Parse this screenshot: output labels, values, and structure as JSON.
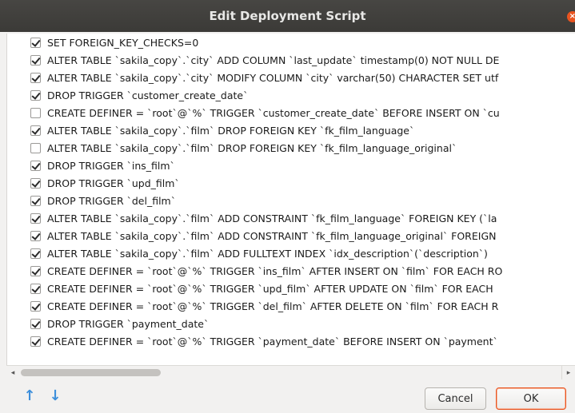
{
  "window": {
    "title": "Edit Deployment Script"
  },
  "items": [
    {
      "checked": true,
      "text": "SET FOREIGN_KEY_CHECKS=0"
    },
    {
      "checked": true,
      "text": "ALTER TABLE `sakila_copy`.`city` ADD COLUMN `last_update` timestamp(0) NOT NULL DE"
    },
    {
      "checked": true,
      "text": "ALTER TABLE `sakila_copy`.`city` MODIFY COLUMN `city` varchar(50) CHARACTER SET utf"
    },
    {
      "checked": true,
      "text": "DROP TRIGGER `customer_create_date`"
    },
    {
      "checked": false,
      "text": "CREATE DEFINER = `root`@`%` TRIGGER `customer_create_date` BEFORE INSERT ON `cu"
    },
    {
      "checked": true,
      "text": "ALTER TABLE `sakila_copy`.`film` DROP FOREIGN KEY `fk_film_language`"
    },
    {
      "checked": false,
      "text": "ALTER TABLE `sakila_copy`.`film` DROP FOREIGN KEY `fk_film_language_original`"
    },
    {
      "checked": true,
      "text": "DROP TRIGGER `ins_film`"
    },
    {
      "checked": true,
      "text": "DROP TRIGGER `upd_film`"
    },
    {
      "checked": true,
      "text": "DROP TRIGGER `del_film`"
    },
    {
      "checked": true,
      "text": "ALTER TABLE `sakila_copy`.`film` ADD CONSTRAINT `fk_film_language` FOREIGN KEY (`la"
    },
    {
      "checked": true,
      "text": "ALTER TABLE `sakila_copy`.`film` ADD CONSTRAINT `fk_film_language_original` FOREIGN"
    },
    {
      "checked": true,
      "text": "ALTER TABLE `sakila_copy`.`film` ADD FULLTEXT INDEX `idx_description`(`description`)"
    },
    {
      "checked": true,
      "text": "CREATE DEFINER = `root`@`%` TRIGGER `ins_film` AFTER INSERT ON `film` FOR EACH RO"
    },
    {
      "checked": true,
      "text": "CREATE DEFINER = `root`@`%` TRIGGER `upd_film` AFTER UPDATE ON `film` FOR EACH"
    },
    {
      "checked": true,
      "text": "CREATE DEFINER = `root`@`%` TRIGGER `del_film` AFTER DELETE ON `film` FOR EACH R"
    },
    {
      "checked": true,
      "text": "DROP TRIGGER `payment_date`"
    },
    {
      "checked": true,
      "text": "CREATE DEFINER = `root`@`%` TRIGGER `payment_date` BEFORE INSERT ON `payment`"
    }
  ],
  "icons": {
    "move_up": "arrow-up-icon",
    "move_down": "arrow-down-icon",
    "close": "close-icon",
    "scroll_left": "scroll-left-icon",
    "scroll_right": "scroll-right-icon"
  },
  "colors": {
    "accent": "#e95420",
    "arrows": "#3d8fdb",
    "titlebar": "#3e3d39"
  },
  "buttons": {
    "cancel": "Cancel",
    "ok": "OK"
  },
  "glyphs": {
    "up": "↑",
    "down": "↓",
    "left": "◂",
    "right": "▸",
    "close": "×"
  }
}
